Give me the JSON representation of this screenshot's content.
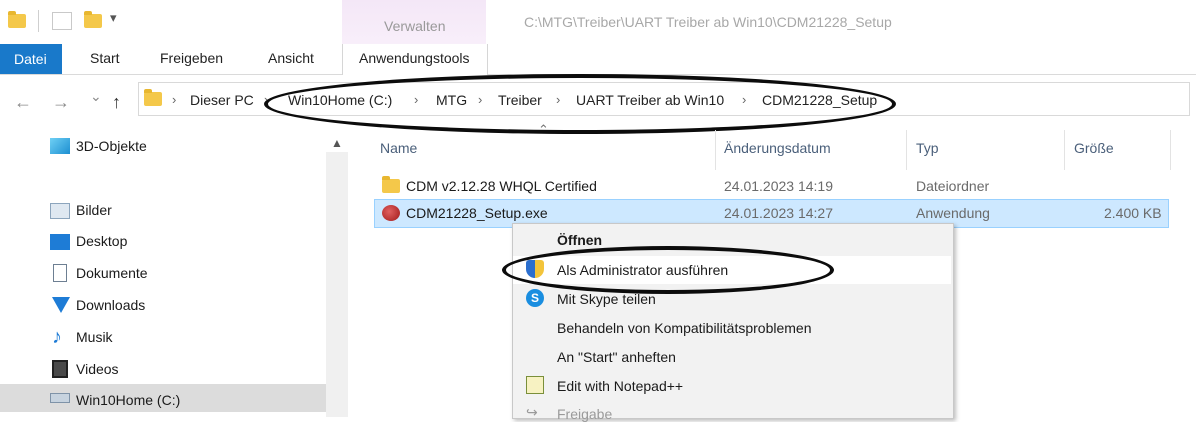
{
  "window": {
    "path_title": "C:\\MTG\\Treiber\\UART Treiber ab Win10\\CDM21228_Setup",
    "qa_dropdown": "▾"
  },
  "ribbon": {
    "context_group_label": "Verwalten",
    "tabs": [
      "Datei",
      "Start",
      "Freigeben",
      "Ansicht",
      "Anwendungstools"
    ]
  },
  "address": {
    "back_glyph": "←",
    "forward_glyph": "→",
    "recent_glyph": "⌄",
    "up_glyph": "↑",
    "separator": "›",
    "crumbs": [
      "Dieser PC",
      "Win10Home (C:)",
      "MTG",
      "Treiber",
      "UART Treiber ab Win10",
      "CDM21228_Setup"
    ]
  },
  "nav": {
    "scroll_up_glyph": "▲",
    "items": [
      {
        "label": "3D-Objekte",
        "icon": "3d-objects-icon"
      },
      {
        "label": "Bilder",
        "icon": "pictures-icon"
      },
      {
        "label": "Desktop",
        "icon": "desktop-icon"
      },
      {
        "label": "Dokumente",
        "icon": "documents-icon"
      },
      {
        "label": "Downloads",
        "icon": "downloads-icon"
      },
      {
        "label": "Musik",
        "icon": "music-icon"
      },
      {
        "label": "Videos",
        "icon": "videos-icon"
      },
      {
        "label": "Win10Home (C:)",
        "icon": "drive-icon"
      }
    ]
  },
  "files": {
    "sort_glyph": "⌃",
    "columns": [
      "Name",
      "Änderungsdatum",
      "Typ",
      "Größe"
    ],
    "rows": [
      {
        "name": "CDM v2.12.28 WHQL Certified",
        "date": "24.01.2023 14:19",
        "type": "Dateiordner",
        "size": ""
      },
      {
        "name": "CDM21228_Setup.exe",
        "date": "24.01.2023 14:27",
        "type": "Anwendung",
        "size": "2.400 KB"
      }
    ]
  },
  "context_menu": {
    "items": [
      {
        "label": "Öffnen"
      },
      {
        "label": "Als Administrator ausführen"
      },
      {
        "label": "Mit Skype teilen"
      },
      {
        "label": "Behandeln von Kompatibilitätsproblemen"
      },
      {
        "label": "An \"Start\" anheften"
      },
      {
        "label": "Edit with Notepad++"
      },
      {
        "label": "Freigabe"
      }
    ]
  },
  "colors": {
    "accent": "#1979ca",
    "selection": "#cde8ff",
    "selection_border": "#99d1ff",
    "manage_tint": "#f4e7f7",
    "annotation": "#0c0c0c"
  }
}
